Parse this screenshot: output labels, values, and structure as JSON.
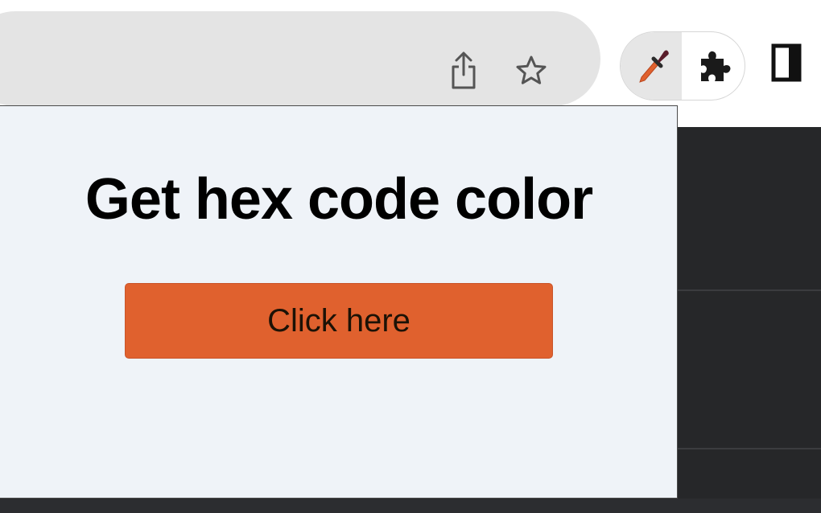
{
  "toolbar": {
    "icons": {
      "share": "share-icon",
      "bookmark": "star-icon",
      "color_picker_extension": "eyedropper-icon",
      "extensions": "puzzle-icon",
      "side_panel": "side-panel-icon"
    },
    "active_extension": "color_picker_extension"
  },
  "popup": {
    "title": "Get hex code color",
    "button_label": "Click here"
  },
  "colors": {
    "button_background": "#e0612e",
    "popup_background": "#eff3f8",
    "page_background": "#262729",
    "omnibox_background": "#e4e4e4"
  }
}
